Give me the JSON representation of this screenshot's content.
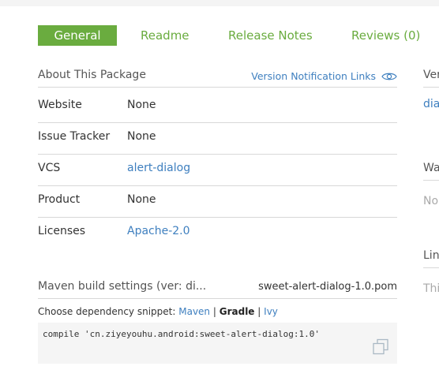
{
  "tabs": [
    {
      "label": "General",
      "active": true
    },
    {
      "label": "Readme",
      "active": false
    },
    {
      "label": "Release Notes",
      "active": false
    },
    {
      "label": "Reviews (0)",
      "active": false
    }
  ],
  "about": {
    "title": "About This Package",
    "version_notification_label": "Version Notification Links",
    "rows": [
      {
        "key": "Website",
        "value": "None"
      },
      {
        "key": "Issue Tracker",
        "value": "None"
      },
      {
        "key": "VCS",
        "value": "alert-dialog"
      },
      {
        "key": "Product",
        "value": "None"
      },
      {
        "key": "Licenses",
        "value": "Apache-2.0"
      }
    ]
  },
  "maven": {
    "title": "Maven build settings (ver: di...",
    "file": "sweet-alert-dialog-1.0.pom",
    "choose_label": "Choose dependency snippet:",
    "options": [
      "Maven",
      "Gradle",
      "Ivy"
    ],
    "separator": "|",
    "selected": "Gradle",
    "code": "compile 'cn.ziyeyouhu.android:sweet-alert-dialog:1.0'"
  },
  "side": {
    "header1": "Ver",
    "link1": "dia",
    "header2": "Wa",
    "muted1": "No",
    "header3": "Lin",
    "muted2": "Thi"
  },
  "colors": {
    "accent_green": "#6aac3f",
    "link_blue": "#3e7fbf"
  },
  "icons": {
    "eye": "eye-icon",
    "copy": "copy-icon"
  }
}
